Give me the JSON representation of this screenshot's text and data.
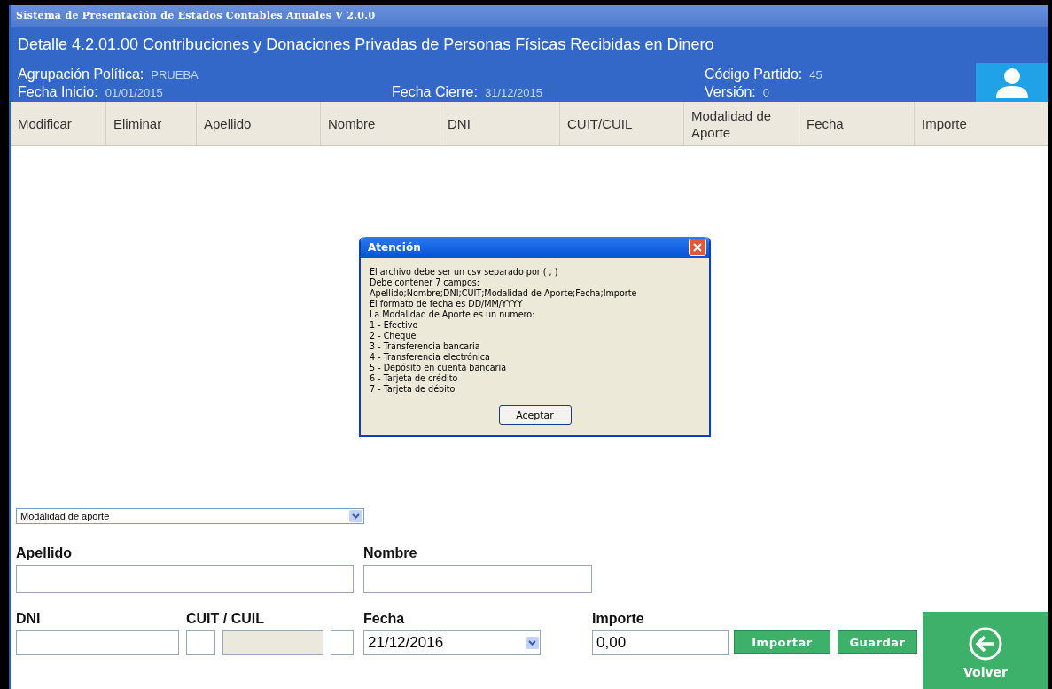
{
  "window": {
    "title": "Sistema de Presentación de Estados Contables Anuales V 2.0.0"
  },
  "header": {
    "title": "Detalle 4.2.01.00 Contribuciones y Donaciones Privadas de Personas Físicas Recibidas en Dinero",
    "fields": [
      {
        "label": "Agrupación Política:",
        "value": "PRUEBA"
      },
      {
        "label": "Fecha Inicio:",
        "value": "01/01/2015"
      },
      {
        "label": "Fecha Cierre:",
        "value": "31/12/2015"
      },
      {
        "label": "Código Partido:",
        "value": "45"
      },
      {
        "label": "Versión:",
        "value": "0"
      }
    ]
  },
  "table": {
    "columns": [
      "Modificar",
      "Eliminar",
      "Apellido",
      "Nombre",
      "DNI",
      "CUIT/CUIL",
      "Modalidad de Aporte",
      "Fecha",
      "Importe"
    ]
  },
  "dialog": {
    "title": "Atención",
    "lines": [
      "El archivo debe ser un csv separado por ( ; )",
      "Debe contener 7 campos:",
      "Apellido;Nombre;DNI;CUIT;Modalidad de Aporte;Fecha;Importe",
      "El formato de fecha es DD/MM/YYYY",
      "La Modalidad de Aporte es un numero:",
      "1 - Efectivo",
      "2 - Cheque",
      "3 - Transferencia bancaria",
      "4 - Transferencia electrónica",
      "5 - Depósito en cuenta bancaria",
      "6 - Tarjeta de crédito",
      "7 - Tarjeta de débito"
    ],
    "button": "Aceptar"
  },
  "form": {
    "modalidad": {
      "value": "Modalidad de aporte"
    },
    "apellido": {
      "label": "Apellido"
    },
    "nombre": {
      "label": "Nombre"
    },
    "dni": {
      "label": "DNI"
    },
    "cuit": {
      "label": "CUIT / CUIL"
    },
    "fecha": {
      "label": "Fecha",
      "value": "21/12/2016"
    },
    "importe": {
      "label": "Importe",
      "value": "0,00"
    },
    "buttons": [
      "Importar",
      "Guardar"
    ],
    "back": "Volver"
  }
}
